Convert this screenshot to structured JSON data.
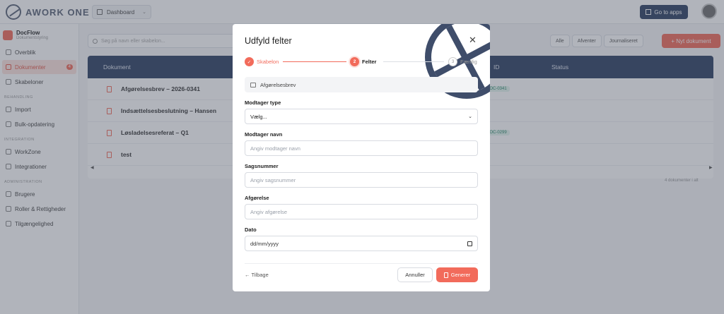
{
  "topbar": {
    "logo_text": "AWORK ONE",
    "workspace": "Dashboard",
    "go_to_apps": "Go to apps"
  },
  "sidebar": {
    "app_name": "DocFlow",
    "app_subtitle": "Dokumentstyring",
    "items_top": [
      {
        "label": "Overblik",
        "icon": "dashboard-icon"
      },
      {
        "label": "Dokumenter",
        "icon": "document-icon",
        "count": "4"
      },
      {
        "label": "Skabeloner",
        "icon": "template-icon"
      }
    ],
    "section_bulk": "BEHANDLING",
    "items_bulk": [
      {
        "label": "Import",
        "icon": "import-icon"
      },
      {
        "label": "Bulk-opdatering",
        "icon": "refresh-icon"
      }
    ],
    "section_integration": "INTEGRATION",
    "items_integration": [
      {
        "label": "WorkZone",
        "icon": "link-icon"
      },
      {
        "label": "Integrationer",
        "icon": "plug-icon"
      }
    ],
    "section_admin": "ADMINISTRATION",
    "items_admin": [
      {
        "label": "Brugere",
        "icon": "users-icon"
      },
      {
        "label": "Roller & Rettigheder",
        "icon": "key-icon"
      },
      {
        "label": "Tilgængelighed",
        "icon": "eye-icon"
      }
    ]
  },
  "main": {
    "search_placeholder": "Søg på navn eller skabelon...",
    "filters": [
      "Alle",
      "Afventer",
      "Journaliseret"
    ],
    "new_doc": "+ Nyt dokument",
    "columns": [
      "Dokument",
      "ID",
      "Status"
    ],
    "rows": [
      {
        "name": "Afgørelsesbrev – 2026-0341",
        "tag": "DOC-0341"
      },
      {
        "name": "Indsættelsesbeslutning – Hansen",
        "tag": ""
      },
      {
        "name": "Løsladelsesreferat – Q1",
        "tag": "DOC-0299"
      },
      {
        "name": "test",
        "tag": ""
      }
    ],
    "count_text": "4 dokumenter i alt"
  },
  "modal": {
    "title": "Udfyld felter",
    "steps": [
      {
        "num": "✓",
        "label": "Skabelon"
      },
      {
        "num": "2",
        "label": "Felter"
      },
      {
        "num": "3",
        "label": "Færdig"
      }
    ],
    "template_name": "Afgørelsesbrev",
    "fields": {
      "modtager_type_label": "Modtager type",
      "modtager_type_value": "Vælg...",
      "modtager_navn_label": "Modtager navn",
      "modtager_navn_placeholder": "Angiv modtager navn",
      "sagsnummer_label": "Sagsnummer",
      "sagsnummer_placeholder": "Angiv sagsnummer",
      "afgoerelse_label": "Afgørelse",
      "afgoerelse_placeholder": "Angiv afgørelse",
      "dato_label": "Dato",
      "dato_value": "dd/mm/yyyy"
    },
    "back": "← Tilbage",
    "cancel": "Annuller",
    "generate": "Generer"
  }
}
